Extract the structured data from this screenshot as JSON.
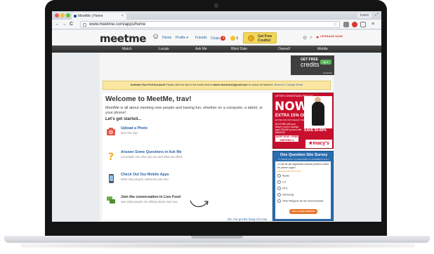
{
  "browser": {
    "tab_title": "MeetMe | Home",
    "url": "www.meetme.com/apps/home",
    "user_label": "travis",
    "nav": {
      "back": "←",
      "forward": "→",
      "reload": "C"
    }
  },
  "header": {
    "logo": "meetme",
    "nav": {
      "home": "Home",
      "profile": "Profile ▾",
      "friends": "Friends",
      "chats": "Chats",
      "chats_count": "1",
      "credits_count": "0"
    },
    "credits_button": "Get Free Credits!",
    "upgrade": "UPGRADE NOW!"
  },
  "mainnav": [
    "Match",
    "Locals",
    "Ask Me",
    "Blind Date",
    "Owned!",
    "Mobile"
  ],
  "promo": {
    "line1": "GET FREE",
    "line2": "credits",
    "toggle": "■ 4",
    "brand": "socialVibe"
  },
  "activate": {
    "title": "Activate Your Full Account!",
    "text": " Please click the link in the email sent to ",
    "email": "travis.henson1@gmail.com",
    "text2": " to unlock all features. ",
    "resend": "Resend",
    "sep": " • ",
    "change": "Change Email"
  },
  "welcome": {
    "title": "Welcome to MeetMe, trav!",
    "intro": "MeetMe is all about meeting new people and having fun, whether on a computer, a tablet, or your phone!",
    "subtitle": "Let's get started...",
    "steps": [
      {
        "title": "Upload a Photo",
        "desc": "Don't be shy!"
      },
      {
        "title": "Answer Some Questions in Ask Me",
        "desc": "Let people see who you are and what you think."
      },
      {
        "title": "Check Out Our Mobile Apps",
        "desc": "Meet new people, wherever you are!"
      },
      {
        "title": "Join the conversation in Live Feed",
        "desc": "See what people are talking about near you."
      }
    ],
    "ok_link": "OK, I've got the hang of it now."
  },
  "ad": {
    "line1": "AFTER CHRISTMAS PRICES",
    "big": "NOW!",
    "extra": "EXTRA 15% OFF",
    "extra_sub": "EXTRA 10% OFF SELECT DEPTS.",
    "details": "IN-STORE with your Macy's Card or savings pass ONLINE promo code WRAPUP",
    "shop": "SHOP NOW › FREE SHIPPING & RETURNS",
    "save": "SAVE 50-60%",
    "brand": "★macy's"
  },
  "survey": {
    "title": "One Question Site Survey",
    "subtitle": "IT TAKES ONLY 10 SECONDS TO ANSWER IN FULL",
    "question": "¿Cuál de las siguientes marcas prefiere usted en primer lugar?",
    "hint": "SELECCIONE SOLO UNA",
    "options": [
      "Apple",
      "LG",
      "HTC",
      "Samsung",
      "Otra/ Ninguna de las mencionadas"
    ],
    "button": "VEA LO QUE PIENSAN"
  },
  "colors": {
    "accent": "#2a63a8",
    "ad_red": "#c8102e",
    "survey_blue": "#2b6cb0",
    "activate_bg": "#fbe7a1"
  }
}
